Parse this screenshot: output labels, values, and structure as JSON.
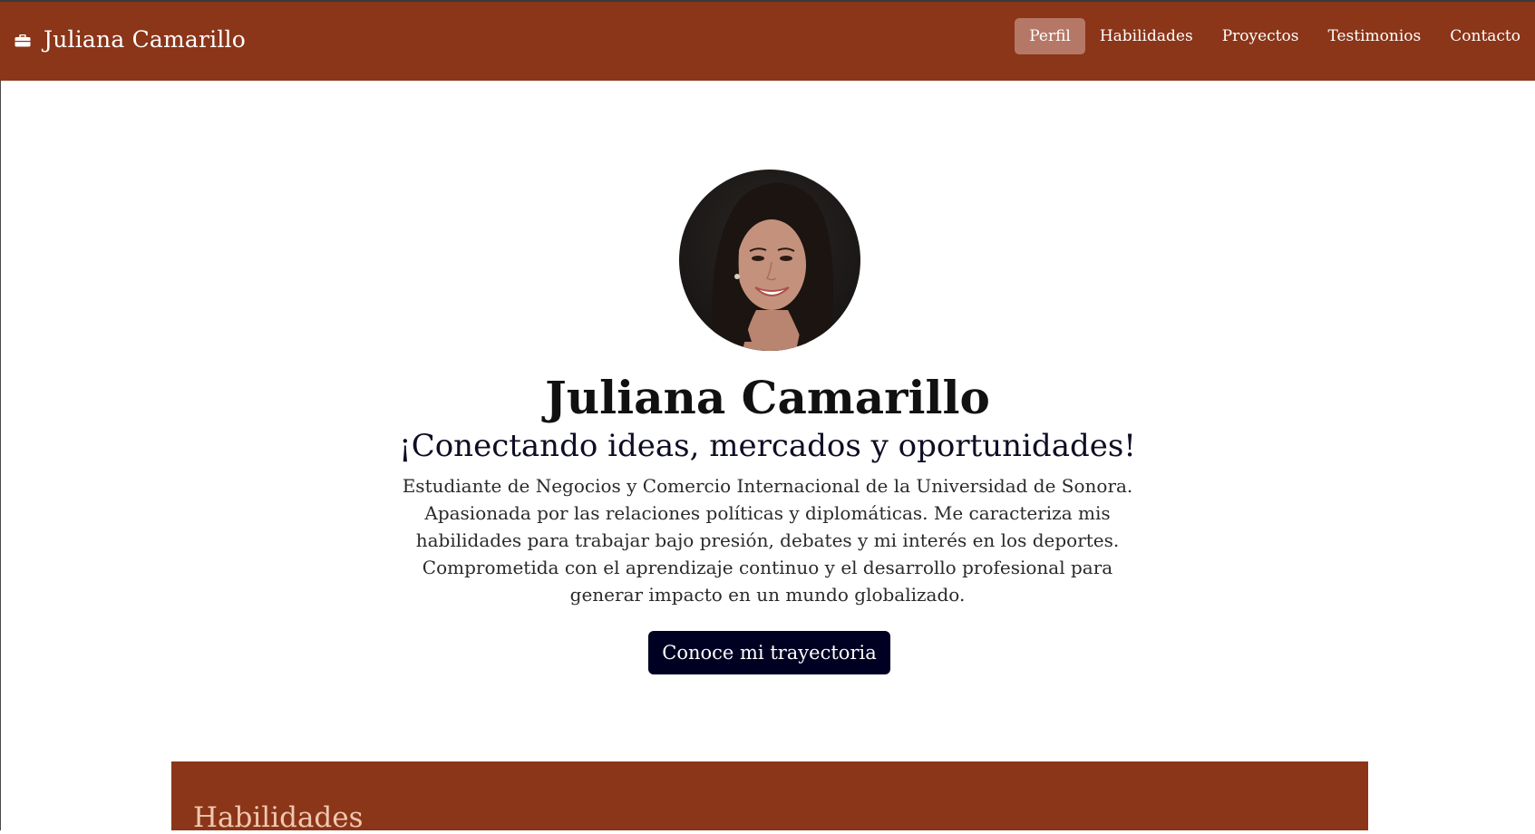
{
  "navbar": {
    "brand_icon": "briefcase-icon",
    "brand_name": "Juliana Camarillo",
    "links": [
      {
        "label": "Perfil",
        "active": true
      },
      {
        "label": "Habilidades",
        "active": false
      },
      {
        "label": "Proyectos",
        "active": false
      },
      {
        "label": "Testimonios",
        "active": false
      },
      {
        "label": "Contacto",
        "active": false
      }
    ]
  },
  "hero": {
    "name": "Juliana Camarillo",
    "tagline": "¡Conectando ideas, mercados y oportunidades!",
    "bio": "Estudiante de Negocios y Comercio Internacional de la Universidad de Sonora. Apasionada por las relaciones políticas y diplomáticas. Me caracteriza mis habilidades para trabajar bajo presión, debates y mi interés en los deportes. Comprometida con el aprendizaje continuo y el desarrollo profesional para generar impacto en un mundo globalizado.",
    "cta_label": "Conoce mi trayectoria"
  },
  "skills": {
    "title": "Habilidades"
  },
  "colors": {
    "brand": "#8b3519",
    "active_nav": "#b57867",
    "cta": "#000022"
  }
}
